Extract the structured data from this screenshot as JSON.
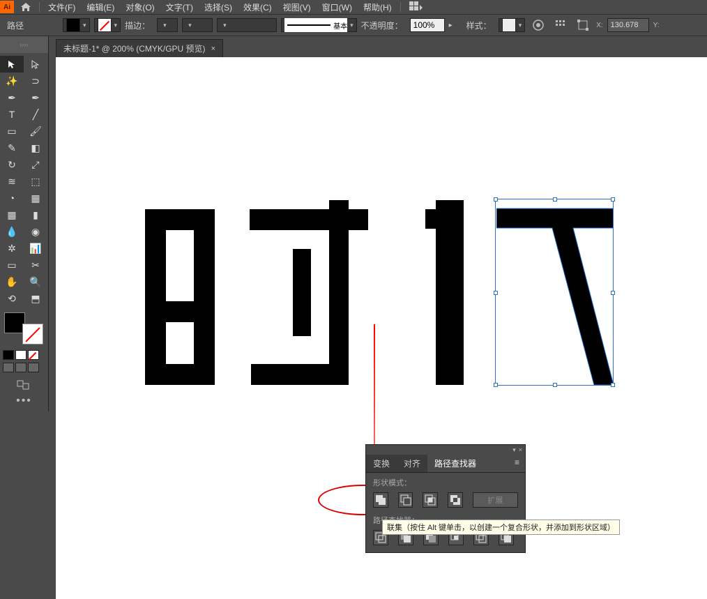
{
  "app": {
    "logo": "Ai"
  },
  "menu": {
    "file": "文件(F)",
    "edit": "编辑(E)",
    "object": "对象(O)",
    "type": "文字(T)",
    "select": "选择(S)",
    "effect": "效果(C)",
    "view": "视图(V)",
    "window": "窗口(W)",
    "help": "帮助(H)"
  },
  "options": {
    "path_label": "路径",
    "stroke_label": "描边：",
    "stroke_style": "基本",
    "opacity_label": "不透明度：",
    "opacity_value": "100%",
    "style_label": "样式：",
    "x_label": "X:",
    "x_value": "130.678",
    "y_label": "Y:"
  },
  "tab": {
    "title": "未标题-1* @ 200% (CMYK/GPU 预览)"
  },
  "panel": {
    "tabs": {
      "transform": "变换",
      "align": "对齐",
      "pathfinder": "路径查找器"
    },
    "shape_modes_label": "形状模式：",
    "pathfinders_label": "路径查找器：",
    "expand_label": "扩展"
  },
  "tooltip": "联集（按住 Alt 键单击，以创建一个复合形状，并添加到形状区域）"
}
